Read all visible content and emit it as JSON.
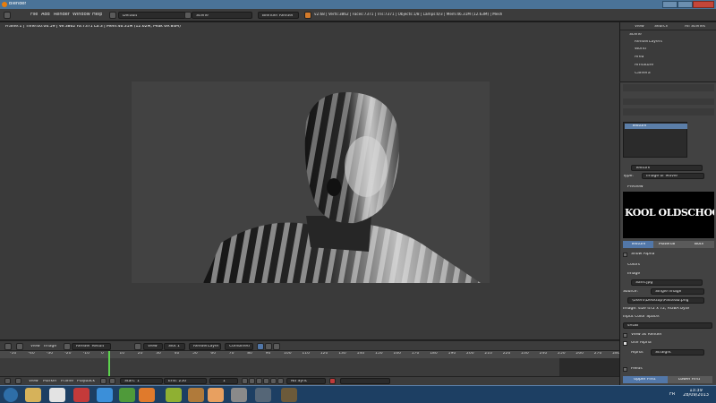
{
  "window": {
    "title": "Blender"
  },
  "infobar": {
    "menus": [
      "File",
      "Add",
      "Render",
      "Window",
      "Help"
    ],
    "screen_layout": "Default",
    "scene": "Scene",
    "engine": "Blender Render",
    "stats": "v2.68 | Verts:3862 | Faces:7371 | Tris:7371 | Objects:1/8 | Lamps:0/3 | Mem:46.31M (12.63M) | Mesh"
  },
  "view3d": {
    "render_status": "Frame:1 | Time:00:06.59 | Ve:3862 Fa:7371 La:3 | Mem:46.31M (12.62M, Peak 69.84M)"
  },
  "image_header": {
    "menus": [
      "View",
      "Image"
    ],
    "image_name": "Render Result",
    "view_label": "View",
    "slot": "Slot 1",
    "render_layer": "RenderLayer",
    "pass": "Combined"
  },
  "timeline": {
    "ticks": [
      "-50",
      "-40",
      "-30",
      "-20",
      "-10",
      "0",
      "10",
      "20",
      "30",
      "40",
      "50",
      "60",
      "70",
      "80",
      "90",
      "100",
      "110",
      "120",
      "130",
      "140",
      "150",
      "160",
      "170",
      "180",
      "190",
      "200",
      "210",
      "220",
      "230",
      "240",
      "250",
      "260",
      "270",
      "280"
    ],
    "controls": [
      "View",
      "Marker",
      "Frame",
      "Playback"
    ],
    "start_label": "Start: 1",
    "end_label": "End: 250",
    "current_frame": "1",
    "sync": "No Sync"
  },
  "outliner": {
    "header": [
      "View",
      "Search",
      "All Scenes"
    ],
    "items": [
      "Scene",
      "RenderLayers",
      "World",
      "Area",
      "Armature",
      "Camera"
    ]
  },
  "properties": {
    "texture_slot_name": "Texture",
    "texture_datablock": "Texture",
    "type_label": "Type:",
    "type_value": "Image or Movie",
    "preview_label": "Preview",
    "preview_text": "KOOL OLDSCHOOL OLDS",
    "preview_tabs": [
      "Texture",
      "Material",
      "Both"
    ],
    "show_alpha": "Show Alpha",
    "colors_label": "Colors",
    "image_label": "Image",
    "image_name": "Sans.jpg",
    "source_label": "Source:",
    "source_value": "Single Image",
    "filepath": "\\Users\\Desktop\\Pasteab.png",
    "image_info": "Image: size 472 x 72, RGBA byte",
    "color_space_label": "Input Color Space:",
    "color_space_value": "sRGB",
    "view_as_render": "View as Render",
    "use_alpha": "Use Alpha",
    "alpha_label": "Alpha:",
    "alpha_value": "Straight",
    "fields": "Fields",
    "bottom_buttons": [
      "Upper First",
      "Lower First"
    ]
  },
  "taskbar": {
    "language": "FR",
    "time": "13:39",
    "date": "28/09/2013"
  }
}
